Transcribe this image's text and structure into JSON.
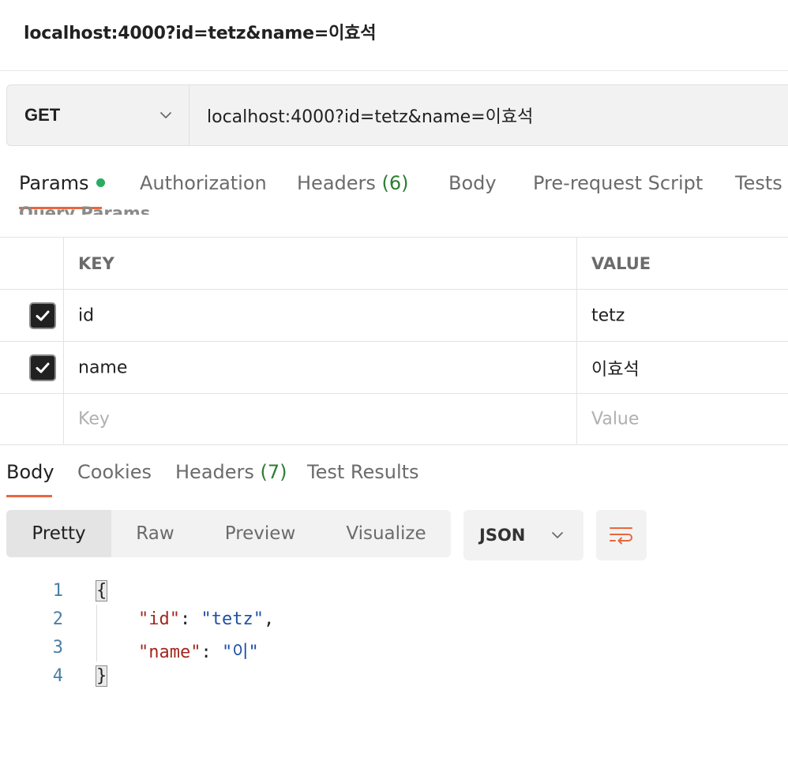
{
  "request": {
    "title": "localhost:4000?id=tetz&name=이효석",
    "method": "GET",
    "url": "localhost:4000?id=tetz&name=이효석"
  },
  "request_tabs": {
    "params": "Params",
    "authorization": "Authorization",
    "headers": "Headers",
    "headers_count": "(6)",
    "body": "Body",
    "pre_request_script": "Pre-request Script",
    "tests": "Tests"
  },
  "query_params": {
    "section_label": "Query Params",
    "columns": {
      "key": "KEY",
      "value": "VALUE"
    },
    "rows": [
      {
        "checked": true,
        "key": "id",
        "value": "tetz"
      },
      {
        "checked": true,
        "key": "name",
        "value": "이효석"
      }
    ],
    "placeholder_key": "Key",
    "placeholder_value": "Value"
  },
  "response_tabs": {
    "body": "Body",
    "cookies": "Cookies",
    "headers": "Headers",
    "headers_count": "(7)",
    "test_results": "Test Results"
  },
  "view_modes": {
    "pretty": "Pretty",
    "raw": "Raw",
    "preview": "Preview",
    "visualize": "Visualize",
    "active": "Pretty"
  },
  "format": {
    "selected": "JSON"
  },
  "response_body": {
    "line_numbers": [
      "1",
      "2",
      "3",
      "4"
    ],
    "open_brace": "{",
    "close_brace": "}",
    "key_id": "\"id\"",
    "val_id": "\"tetz\"",
    "key_name": "\"name\"",
    "val_name": "\"이\""
  },
  "icons": {
    "method_dropdown": "chevron-down-icon",
    "format_dropdown": "chevron-down-icon",
    "wrap": "wrap-lines-icon",
    "checkbox": "check-icon"
  },
  "colors": {
    "accent": "#e8673c",
    "param_dot": "#27ae60",
    "count_green": "#2e7d32",
    "json_key": "#a3271e",
    "json_string": "#1f4fa8",
    "line_number": "#4a7fa3"
  }
}
